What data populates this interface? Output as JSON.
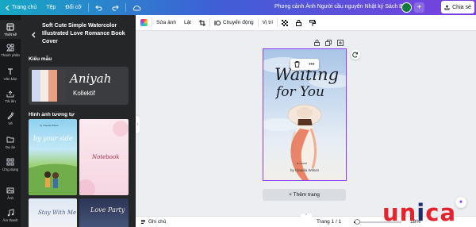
{
  "topbar": {
    "home": "Trang chủ",
    "file": "Tệp",
    "resize": "Đổi cỡ",
    "doc_title": "Phong cảnh Ảnh Người cầu nguyện Nhật ký Sách Bìa",
    "share": "Chia sẻ"
  },
  "rail": [
    {
      "label": "Thiết kế",
      "icon": "layout-icon"
    },
    {
      "label": "Thành phần",
      "icon": "elements-icon"
    },
    {
      "label": "Văn bản",
      "icon": "text-icon"
    },
    {
      "label": "Tải lên",
      "icon": "upload-icon"
    },
    {
      "label": "Vẽ",
      "icon": "draw-icon"
    },
    {
      "label": "Dự án",
      "icon": "folder-icon"
    },
    {
      "label": "Ứng dụng",
      "icon": "apps-icon"
    },
    {
      "label": "Ảnh",
      "icon": "photo-icon"
    },
    {
      "label": "Âm thanh",
      "icon": "audio-icon"
    }
  ],
  "panel": {
    "title": "Soft Cute Simple Watercolor Illustrated Love Romance Book Cover",
    "style_section": "Kiểu mẫu",
    "style_font_a": "Aniyah",
    "style_font_b": "Kollektif",
    "similar_section": "Hình ảnh tương tự",
    "thumb1_title": "by your side",
    "thumb1_author": "by Claudia Wilson",
    "thumb2_title": "Notebook",
    "thumb3_title": "Stay With Me",
    "thumb4_title": "Love Party"
  },
  "swatches": [
    "#cfdaf0",
    "#f5ede4",
    "#e89f82",
    "#3f3f42"
  ],
  "toolbar": {
    "edit_image": "Sửa ảnh",
    "flip": "Lật",
    "animate": "Chuyển động",
    "position": "Vị trí"
  },
  "book": {
    "title_line1": "Waiting",
    "title_line2": "for You",
    "subtitle": "a novel",
    "author": "by Claudia Wilson"
  },
  "canvas": {
    "add_page": "+ Thêm trang"
  },
  "bottombar": {
    "notes": "Ghi chú",
    "page_info": "Trang 1 / 1",
    "zoom": "18%",
    "zoom_fraction": 0.18
  },
  "watermark": {
    "text": "unica",
    "colors": [
      "#e4232c",
      "#1e2b6a"
    ]
  }
}
